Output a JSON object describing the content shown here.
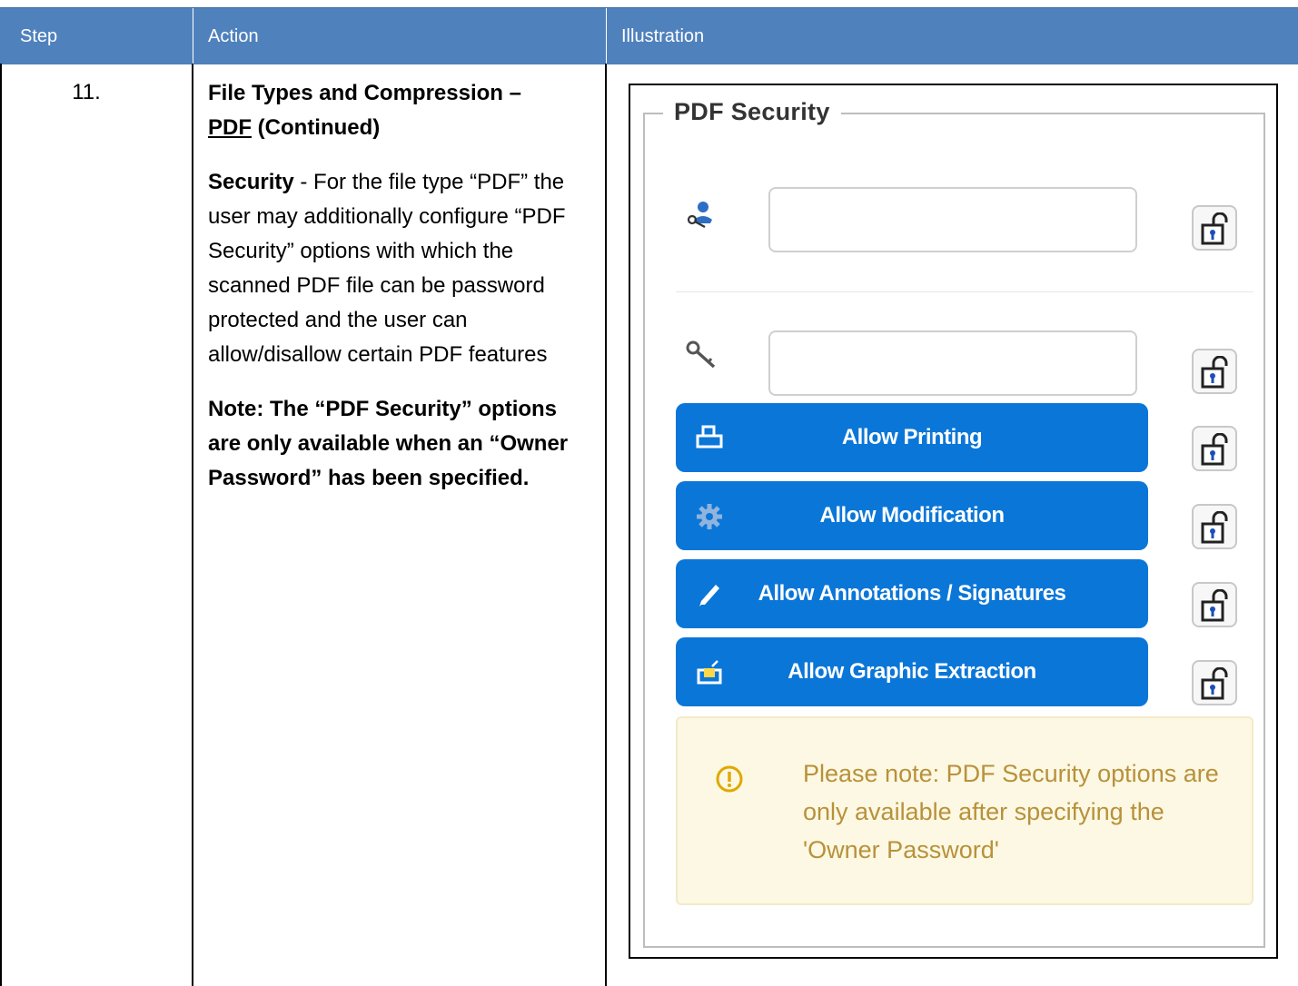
{
  "header": {
    "step": "Step",
    "action": "Action",
    "illustration": "Illustration"
  },
  "row": {
    "step_number": "11.",
    "title_part1": "File Types and Compression –",
    "title_link": "PDF",
    "title_part2": " (Continued)",
    "security_label": "Security",
    "security_text": " - For the file type “PDF” the user may additionally configure “PDF Security” options with which the scanned PDF file can be password protected and the user can allow/disallow certain PDF features",
    "note": "Note: The “PDF Security” options are only available when an “Owner Password” has been specified."
  },
  "panel": {
    "legend": "PDF Security",
    "user_password_value": "",
    "owner_password_value": "",
    "buttons": [
      {
        "label": "Allow Printing",
        "icon": "printer-icon"
      },
      {
        "label": "Allow Modification",
        "icon": "gear-icon"
      },
      {
        "label": "Allow Annotations / Signatures",
        "icon": "pen-icon"
      },
      {
        "label": "Allow Graphic Extraction",
        "icon": "export-icon"
      }
    ],
    "notice": "Please note: PDF Security options are only available after specifying the 'Owner Password'",
    "colors": {
      "header_bg": "#4f81bd",
      "button_bg": "#0a76d8",
      "notice_bg": "#fcf8e3",
      "notice_text": "#b8913b"
    }
  }
}
